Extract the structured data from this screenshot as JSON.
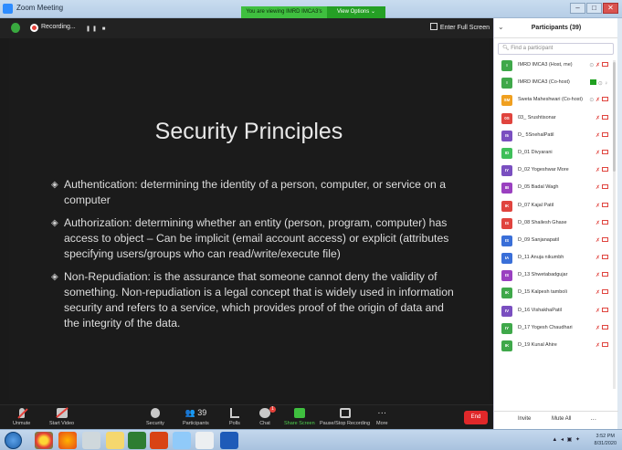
{
  "window": {
    "title": "Zoom Meeting",
    "viewing_banner": "You are viewing IMRD IMCA3's screen",
    "view_options": "View Options ⌄",
    "controls": [
      "–",
      "□",
      "✕"
    ]
  },
  "top_strip": {
    "recording_label": "Recording...",
    "pause_stop": "❚❚ ■",
    "fullscreen_label": "Enter Full Screen"
  },
  "slide": {
    "title": "Security Principles",
    "bullets": [
      "Authentication: determining the identity of a person, computer, or service on a computer",
      "Authorization: determining whether an entity (person, program, computer) has access to object – Can be implicit (email account access) or explicit (attributes specifying users/groups who can read/write/execute file)",
      "Non-Repudiation: is the assurance that someone cannot deny the validity of something. Non-repudiation is a legal concept that is widely used in information security and refers to a service, which provides proof of the origin of data and the integrity of the data."
    ],
    "bullet_marker": "◈"
  },
  "toolbar": {
    "unmute": "Unmute",
    "start_video": "Start Video",
    "security": "Security",
    "participants": "Participants",
    "participants_count": "39",
    "polls": "Polls",
    "chat": "Chat",
    "chat_badge": "1",
    "share_screen": "Share Screen",
    "pause_stop_recording": "Pause/Stop Recording",
    "more": "More",
    "end": "End"
  },
  "participants_panel": {
    "title": "Participants (39)",
    "search_placeholder": "Find a participant",
    "items": [
      {
        "initials": "I",
        "name": "IMRD IMCA3 (Host, me)",
        "color": "#3fa84a"
      },
      {
        "initials": "I",
        "name": "IMRD IMCA3 (Co-host)",
        "color": "#3fa84a"
      },
      {
        "initials": "SM",
        "name": "Sweta Maheshwari (Co-host)",
        "color": "#f0a020"
      },
      {
        "initials": "0S",
        "name": "03_ Srushtisonar",
        "color": "#e0443e"
      },
      {
        "initials": "I5",
        "name": "D_ 5SnehalPatil",
        "color": "#7a4fc0"
      },
      {
        "initials": "ID",
        "name": "D_01 Divyarani",
        "color": "#3fbf5a"
      },
      {
        "initials": "IY",
        "name": "D_02 Yogeshwar More",
        "color": "#7a4fc0"
      },
      {
        "initials": "IB",
        "name": "D_05 Badal Wagh",
        "color": "#9a40c0"
      },
      {
        "initials": "IK",
        "name": "D_07 Kajal Patil",
        "color": "#e0443e"
      },
      {
        "initials": "IS",
        "name": "D_08 Shailesh Ghase",
        "color": "#e0443e"
      },
      {
        "initials": "IS",
        "name": "D_09 Sanjanapatil",
        "color": "#3a6fd8"
      },
      {
        "initials": "IA",
        "name": "D_11 Anuja nikumbh",
        "color": "#3a6fd8"
      },
      {
        "initials": "IS",
        "name": "D_13 Shwetabadgujar",
        "color": "#9a40c0"
      },
      {
        "initials": "IK",
        "name": "D_15 Kalpesh tamboli",
        "color": "#3fa84a"
      },
      {
        "initials": "IV",
        "name": "D_16 VishakhaPatil",
        "color": "#7a4fc0"
      },
      {
        "initials": "IY",
        "name": "D_17 Yogesh Chaudhari",
        "color": "#3fa84a"
      },
      {
        "initials": "IK",
        "name": "D_19 Kunal Ahire",
        "color": "#3fa84a"
      }
    ],
    "invite": "Invite",
    "mute_all": "Mute All",
    "more": "..."
  },
  "taskbar": {
    "tray": "▲ ◂ ▣ ✦",
    "time": "3:52 PM",
    "date": "8/31/2020"
  }
}
